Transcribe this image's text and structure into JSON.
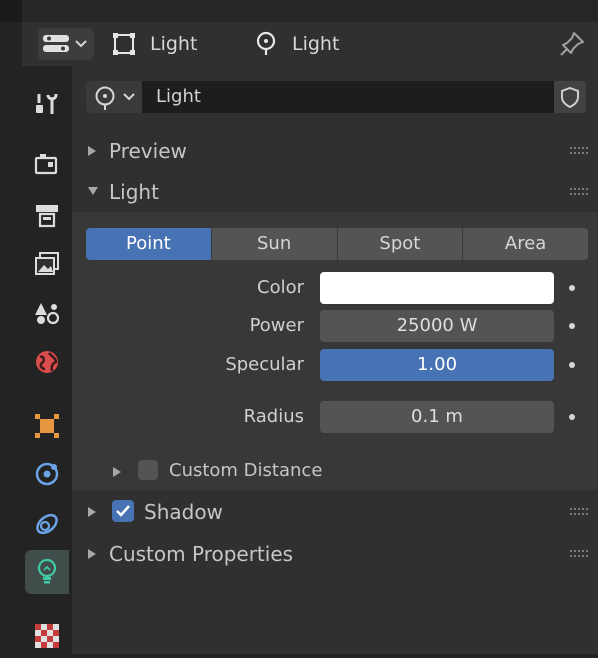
{
  "header": {
    "context_object_label": "Light",
    "context_data_label": "Light"
  },
  "datablock": {
    "name": "Light"
  },
  "sections": {
    "preview": "Preview",
    "light": "Light",
    "shadow": "Shadow",
    "custom_properties": "Custom Properties"
  },
  "light_types": [
    "Point",
    "Sun",
    "Spot",
    "Area"
  ],
  "light_type_selected": "Point",
  "properties": {
    "color_label": "Color",
    "color_value": "#ffffff",
    "power_label": "Power",
    "power_value": "25000 W",
    "specular_label": "Specular",
    "specular_value": "1.00",
    "radius_label": "Radius",
    "radius_value": "0.1 m"
  },
  "custom_distance": {
    "label": "Custom Distance",
    "checked": false
  },
  "shadow_checked": true,
  "tabs": [
    "tool-tab",
    "render-tab",
    "output-tab",
    "view-layer-tab",
    "scene-tab",
    "world-tab",
    "object-tab",
    "physics-tab",
    "constraints-tab",
    "light-data-tab",
    "texture-tab"
  ],
  "active_tab": "light-data-tab",
  "colors": {
    "accent": "#4772b3",
    "active_tab_icon": "#3fc9a4",
    "object_orange": "#e8963f",
    "world_red": "#d94d4d",
    "modifier_blue": "#6aa3e6"
  }
}
